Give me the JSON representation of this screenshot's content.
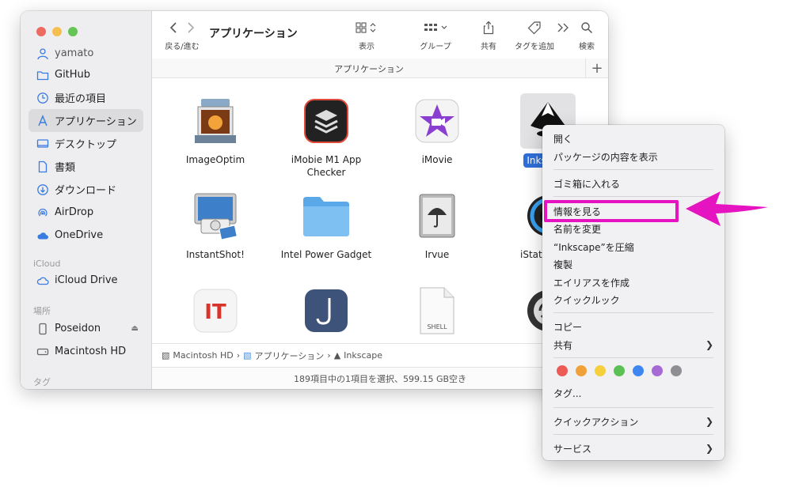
{
  "sidebar": {
    "items": [
      {
        "label": "yamato",
        "icon": "user-icon"
      },
      {
        "label": "GitHub",
        "icon": "folder-icon"
      },
      {
        "label": "最近の項目",
        "icon": "clock-icon"
      },
      {
        "label": "アプリケーション",
        "icon": "applications-icon",
        "selected": true
      },
      {
        "label": "デスクトップ",
        "icon": "desktop-icon"
      },
      {
        "label": "書類",
        "icon": "document-icon"
      },
      {
        "label": "ダウンロード",
        "icon": "download-icon"
      },
      {
        "label": "AirDrop",
        "icon": "airdrop-icon"
      },
      {
        "label": "OneDrive",
        "icon": "cloud-icon"
      }
    ],
    "icloud_header": "iCloud",
    "icloud_drive": "iCloud Drive",
    "locations_header": "場所",
    "poseidon": "Poseidon",
    "macintosh_hd": "Macintosh HD",
    "tags_header": "タグ"
  },
  "toolbar": {
    "back_forward_label": "戻る/進む",
    "title": "アプリケーション",
    "view_label": "表示",
    "group_label": "グループ",
    "share_label": "共有",
    "tag_label": "タグを追加",
    "search_label": "検索"
  },
  "pathbar": {
    "title": "アプリケーション"
  },
  "apps": [
    {
      "label": "ImageOptim",
      "icon": "imageoptim-icon"
    },
    {
      "label": "iMobie M1 App Checker",
      "icon": "imobie-icon"
    },
    {
      "label": "iMovie",
      "icon": "imovie-icon"
    },
    {
      "label": "Inkscape",
      "icon": "inkscape-icon",
      "selected": true
    },
    {
      "label": "InstantShot!",
      "icon": "instantshot-icon"
    },
    {
      "label": "Intel Power Gadget",
      "icon": "folder-icon"
    },
    {
      "label": "Irvue",
      "icon": "irvue-icon"
    },
    {
      "label": "iStat Menus",
      "icon": "istat-icon"
    },
    {
      "label": "",
      "icon": "itmedia-icon"
    },
    {
      "label": "",
      "icon": "j-app-icon"
    },
    {
      "label": "",
      "icon": "shell-file-icon",
      "badge": "SHELL"
    },
    {
      "label": "",
      "icon": "sync-icon"
    }
  ],
  "crumbs": {
    "hd": "Macintosh HD",
    "apps": "アプリケーション",
    "inkscape": "Inkscape"
  },
  "status": {
    "text": "189項目中の1項目を選択、599.15 GB空き"
  },
  "context_menu": {
    "open": "開く",
    "show_package": "パッケージの内容を表示",
    "trash": "ゴミ箱に入れる",
    "get_info": "情報を見る",
    "rename": "名前を変更",
    "compress": "“Inkscape”を圧縮",
    "duplicate": "複製",
    "make_alias": "エイリアスを作成",
    "quick_look": "クイックルック",
    "copy": "コピー",
    "share": "共有",
    "tags": "タグ...",
    "quick_actions": "クイックアクション",
    "services": "サービス",
    "tag_colors": [
      "#ec5b55",
      "#f0a13a",
      "#f5cf3c",
      "#5cc154",
      "#3f87f0",
      "#a769d6",
      "#8e8e93"
    ]
  },
  "highlight_color": "#e513c0"
}
